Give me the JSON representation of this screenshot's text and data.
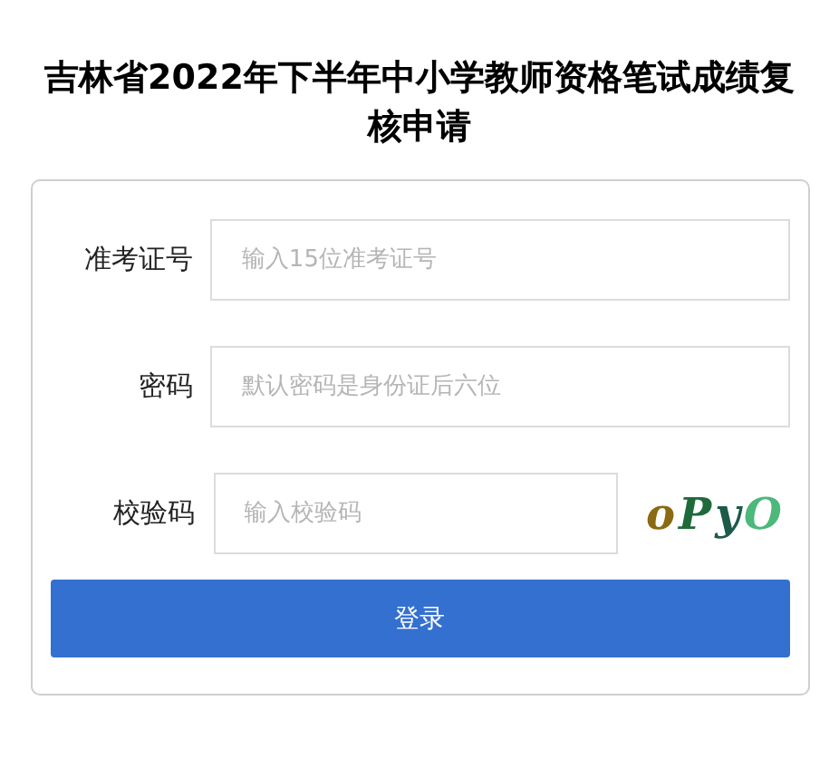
{
  "title": "吉林省2022年下半年中小学教师资格笔试成绩复核申请",
  "fields": [
    {
      "label": "准考证号",
      "placeholder": "输入15位准考证号",
      "kind": "text"
    },
    {
      "label": "密码",
      "placeholder": "默认密码是身份证后六位",
      "kind": "password"
    },
    {
      "label": "校验码",
      "placeholder": "输入校验码",
      "kind": "captcha",
      "captcha": "oPyO"
    }
  ],
  "submit_button": "登录"
}
